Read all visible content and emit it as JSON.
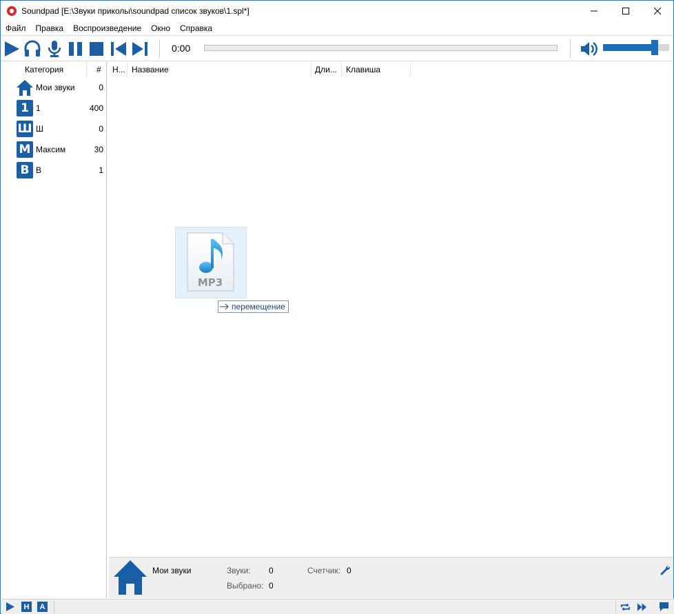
{
  "window": {
    "title": "Soundpad [E:\\Звуки приколы\\soundpad список звуков\\1.spl*]"
  },
  "menu": [
    "Файл",
    "Правка",
    "Воспроизведение",
    "Окно",
    "Справка"
  ],
  "toolbar": {
    "time": "0:00",
    "volume_level": 0.76,
    "icons": [
      "play-icon",
      "headphones-icon",
      "microphone-icon",
      "pause-icon",
      "stop-icon",
      "previous-icon",
      "next-icon",
      "speaker-icon"
    ]
  },
  "categories": {
    "header_name": "Категория",
    "header_count": "#",
    "items": [
      {
        "icon": "home",
        "letter": "",
        "name": "Мои звуки",
        "count": "0"
      },
      {
        "icon": "letter",
        "letter": "1",
        "name": "1",
        "count": "400"
      },
      {
        "icon": "letter",
        "letter": "Ш",
        "name": "Ш",
        "count": "0"
      },
      {
        "icon": "letter",
        "letter": "М",
        "name": "Максим",
        "count": "30"
      },
      {
        "icon": "letter",
        "letter": "В",
        "name": "В",
        "count": "1"
      }
    ]
  },
  "list": {
    "columns": [
      "Н...",
      "Название",
      "Дли...",
      "Клавиша"
    ]
  },
  "drag": {
    "file_label": "MP3",
    "tooltip": "перемещение"
  },
  "info": {
    "category": "Мои звуки",
    "sounds_label": "Звуки:",
    "sounds_value": "0",
    "counter_label": "Счетчик:",
    "counter_value": "0",
    "selected_label": "Выбрано:",
    "selected_value": "0"
  },
  "statusbar": {
    "letter_h": "H",
    "letter_a": "A"
  },
  "colors": {
    "accent": "#1a5fa6",
    "frame": "#1883d7",
    "panel_bg": "#efefef"
  }
}
